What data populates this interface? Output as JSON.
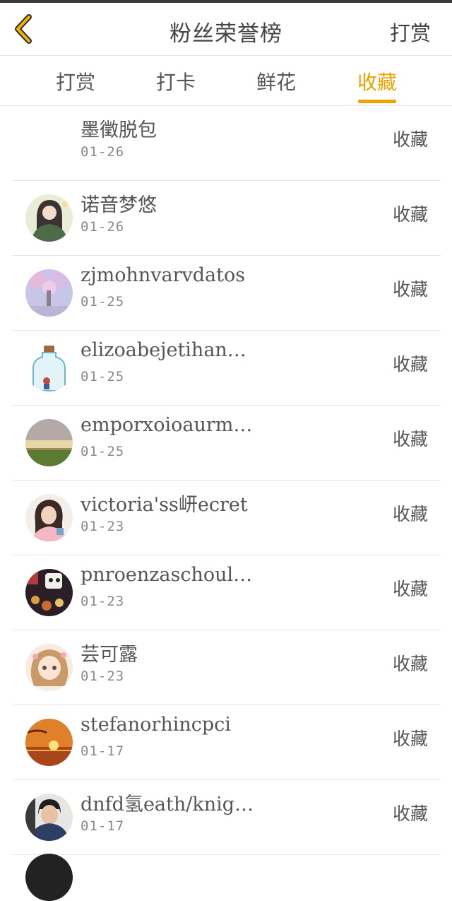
{
  "header": {
    "title": "粉丝荣誉榜",
    "action_label": "打赏",
    "back_icon": "chevron-left-icon"
  },
  "tabs": [
    {
      "label": "打赏",
      "active": false
    },
    {
      "label": "打卡",
      "active": false
    },
    {
      "label": "鲜花",
      "active": false
    },
    {
      "label": "收藏",
      "active": true
    }
  ],
  "colors": {
    "accent": "#f0a200",
    "text": "#555555",
    "subtext": "#8a8a8a",
    "divider": "#e6e6e6"
  },
  "list": [
    {
      "name": "墨徵脱包",
      "date": "01-26",
      "action": "收藏",
      "has_avatar": false
    },
    {
      "name": "诺音梦悠",
      "date": "01-26",
      "action": "收藏",
      "has_avatar": true
    },
    {
      "name": "zjmohnvarvdatos",
      "date": "01-25",
      "action": "收藏",
      "has_avatar": true
    },
    {
      "name": "elizoabejetihan…",
      "date": "01-25",
      "action": "收藏",
      "has_avatar": true
    },
    {
      "name": "emporxoioaurm…",
      "date": "01-25",
      "action": "收藏",
      "has_avatar": true
    },
    {
      "name": "victoria'ss岍ecret",
      "date": "01-23",
      "action": "收藏",
      "has_avatar": true
    },
    {
      "name": "pnroenzaschoul…",
      "date": "01-23",
      "action": "收藏",
      "has_avatar": true
    },
    {
      "name": "芸可露",
      "date": "01-23",
      "action": "收藏",
      "has_avatar": true
    },
    {
      "name": "stefanorhincpci",
      "date": "01-17",
      "action": "收藏",
      "has_avatar": true
    },
    {
      "name": "dnfd氢eath/knig…",
      "date": "01-17",
      "action": "收藏",
      "has_avatar": true
    }
  ]
}
